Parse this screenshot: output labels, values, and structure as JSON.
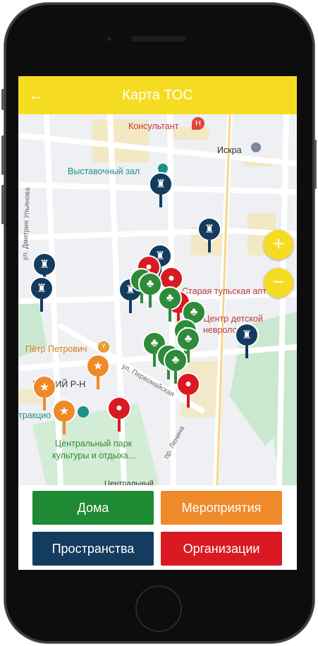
{
  "app": {
    "title": "Карта ТОС",
    "back_icon": "arrow-left-icon"
  },
  "map": {
    "pois": [
      {
        "text": "Консультант",
        "kind": "red"
      },
      {
        "text": "Искра",
        "kind": "dark"
      },
      {
        "text": "Выставочный зал",
        "kind": "teal"
      },
      {
        "text": "Старая тульская апт",
        "kind": "red"
      },
      {
        "text": "\"Центр детской",
        "kind": "red"
      },
      {
        "text": "невроло",
        "kind": "red"
      },
      {
        "text": "Пётр Петрович",
        "kind": "orange"
      },
      {
        "text": "ЕТСКИЙ Р-Н",
        "kind": "dark"
      },
      {
        "text": "тракцио",
        "kind": "teal"
      },
      {
        "text": "Центральный парк",
        "kind": "green"
      },
      {
        "text": "культуры и отдыха...",
        "kind": "green"
      },
      {
        "text": "Центральный",
        "kind": "dark"
      }
    ],
    "streets": [
      {
        "text": "ул. Дмитрия Ульянова"
      },
      {
        "text": "ул. Первомайская"
      },
      {
        "text": "пр. Ленина"
      }
    ],
    "zoom_in_label": "+",
    "zoom_out_label": "−"
  },
  "categories": {
    "homes": {
      "label": "Дома",
      "color": "#1e8a34"
    },
    "events": {
      "label": "Мероприятия",
      "color": "#ee8a2a"
    },
    "spaces": {
      "label": "Пространства",
      "color": "#133c5e"
    },
    "orgs": {
      "label": "Организации",
      "color": "#d91a22"
    }
  }
}
